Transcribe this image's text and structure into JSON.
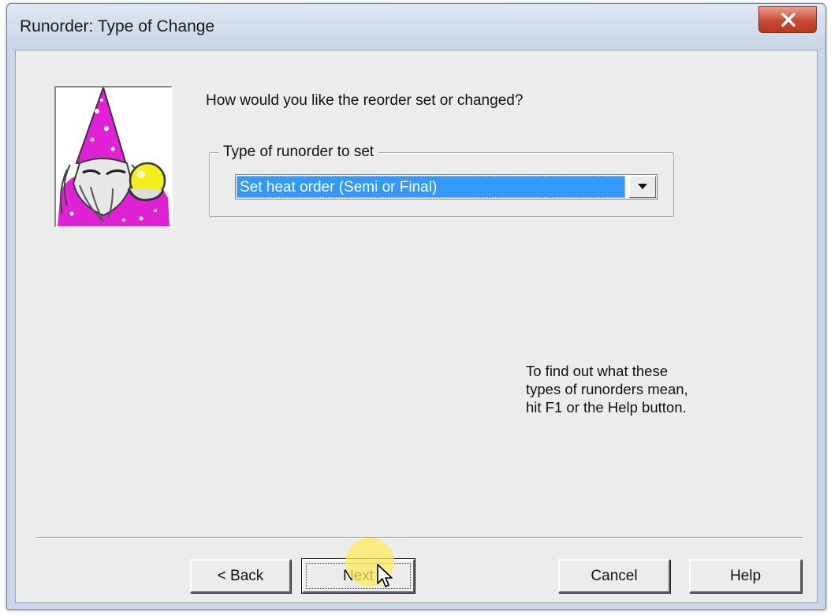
{
  "window": {
    "title": "Runorder: Type of Change"
  },
  "content": {
    "question": "How would you like the reorder set or changed?",
    "group_label": "Type of runorder to set",
    "combo_selected": "Set heat order (Semi or Final)",
    "help_note_lines": [
      "To find out what these",
      "types of runorders mean,",
      "hit F1 or the Help button."
    ]
  },
  "buttons": {
    "back": "< Back",
    "next": "Next",
    "cancel": "Cancel",
    "help": "Help"
  },
  "icons": {
    "close": "close-icon",
    "dropdown": "chevron-down-icon",
    "wizard": "wizard-illustration",
    "cursor": "mouse-pointer-icon"
  },
  "colors": {
    "selection": "#3399ff",
    "close_button": "#c94a34",
    "highlight": "#ffec5a",
    "wizard_hat": "#e021d6"
  }
}
